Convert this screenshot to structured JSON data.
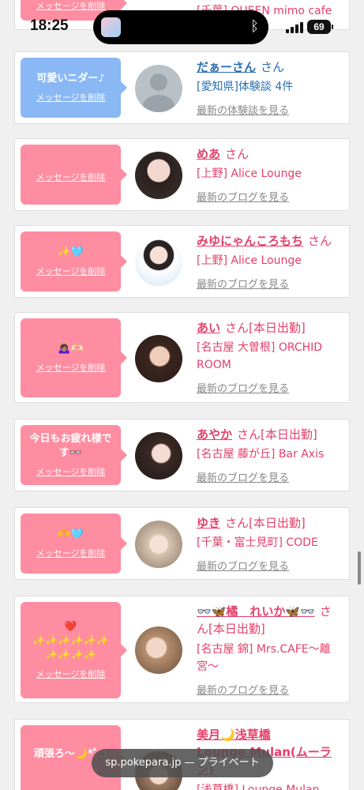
{
  "status": {
    "time": "18:25",
    "battery": "69"
  },
  "browser": {
    "url": "sp.pokepara.jp",
    "mode": "プライベート"
  },
  "delete_label": "メッセージを削除",
  "latest_blog_label": "最新のブログを見る",
  "latest_exp_label": "最新の体験談を見る",
  "top_partial": {
    "shop": "[千葉] QUEEN mimo cafe"
  },
  "cards": [
    {
      "name": "だぁーさん",
      "suffix": "さん",
      "shop": "[愛知県]体験談 4件",
      "message": "可愛いニダー♪",
      "link": "最新の体験談を見る"
    },
    {
      "name": "めあ",
      "suffix": "さん",
      "shop": "[上野] Alice Lounge",
      "message": "",
      "link": "最新のブログを見る"
    },
    {
      "name": "みゆにゃんころもち",
      "suffix": "さん",
      "shop": "[上野] Alice Lounge",
      "message": "✨🩵",
      "link": "最新のブログを見る"
    },
    {
      "name": "あい",
      "suffix": "さん[本日出勤]",
      "shop": "[名古屋 大曽根] ORCHID ROOM",
      "message": "🙇🏽‍♀️🫶🏻",
      "link": "最新のブログを見る"
    },
    {
      "name": "あやか",
      "suffix": "さん[本日出勤]",
      "shop": "[名古屋 藤が丘] Bar Axis",
      "message": "今日もお疲れ様です👓",
      "link": "最新のブログを見る"
    },
    {
      "name": "ゆき",
      "suffix": "さん[本日出勤]",
      "shop": "[千葉・富士見町] CODE",
      "message": "🫶🩵",
      "link": "最新のブログを見る"
    },
    {
      "name": "👓🦋橘　れいか🦋👓",
      "suffix": "さん[本日出勤]",
      "shop": "[名古屋 錦] Mrs.CAFE〜離宮〜",
      "message": "❤️ ✨✨✨✨✨✨ ✨✨✨✨",
      "link": "最新のブログを見る"
    },
    {
      "name": "美月🌙浅草橋",
      "suffix": "Lounge Mulan(ムーラン)",
      "shop": "[浅草橋] Lounge Mulan",
      "message": "頑張ろ〜🌙*゜:",
      "link": ""
    }
  ]
}
